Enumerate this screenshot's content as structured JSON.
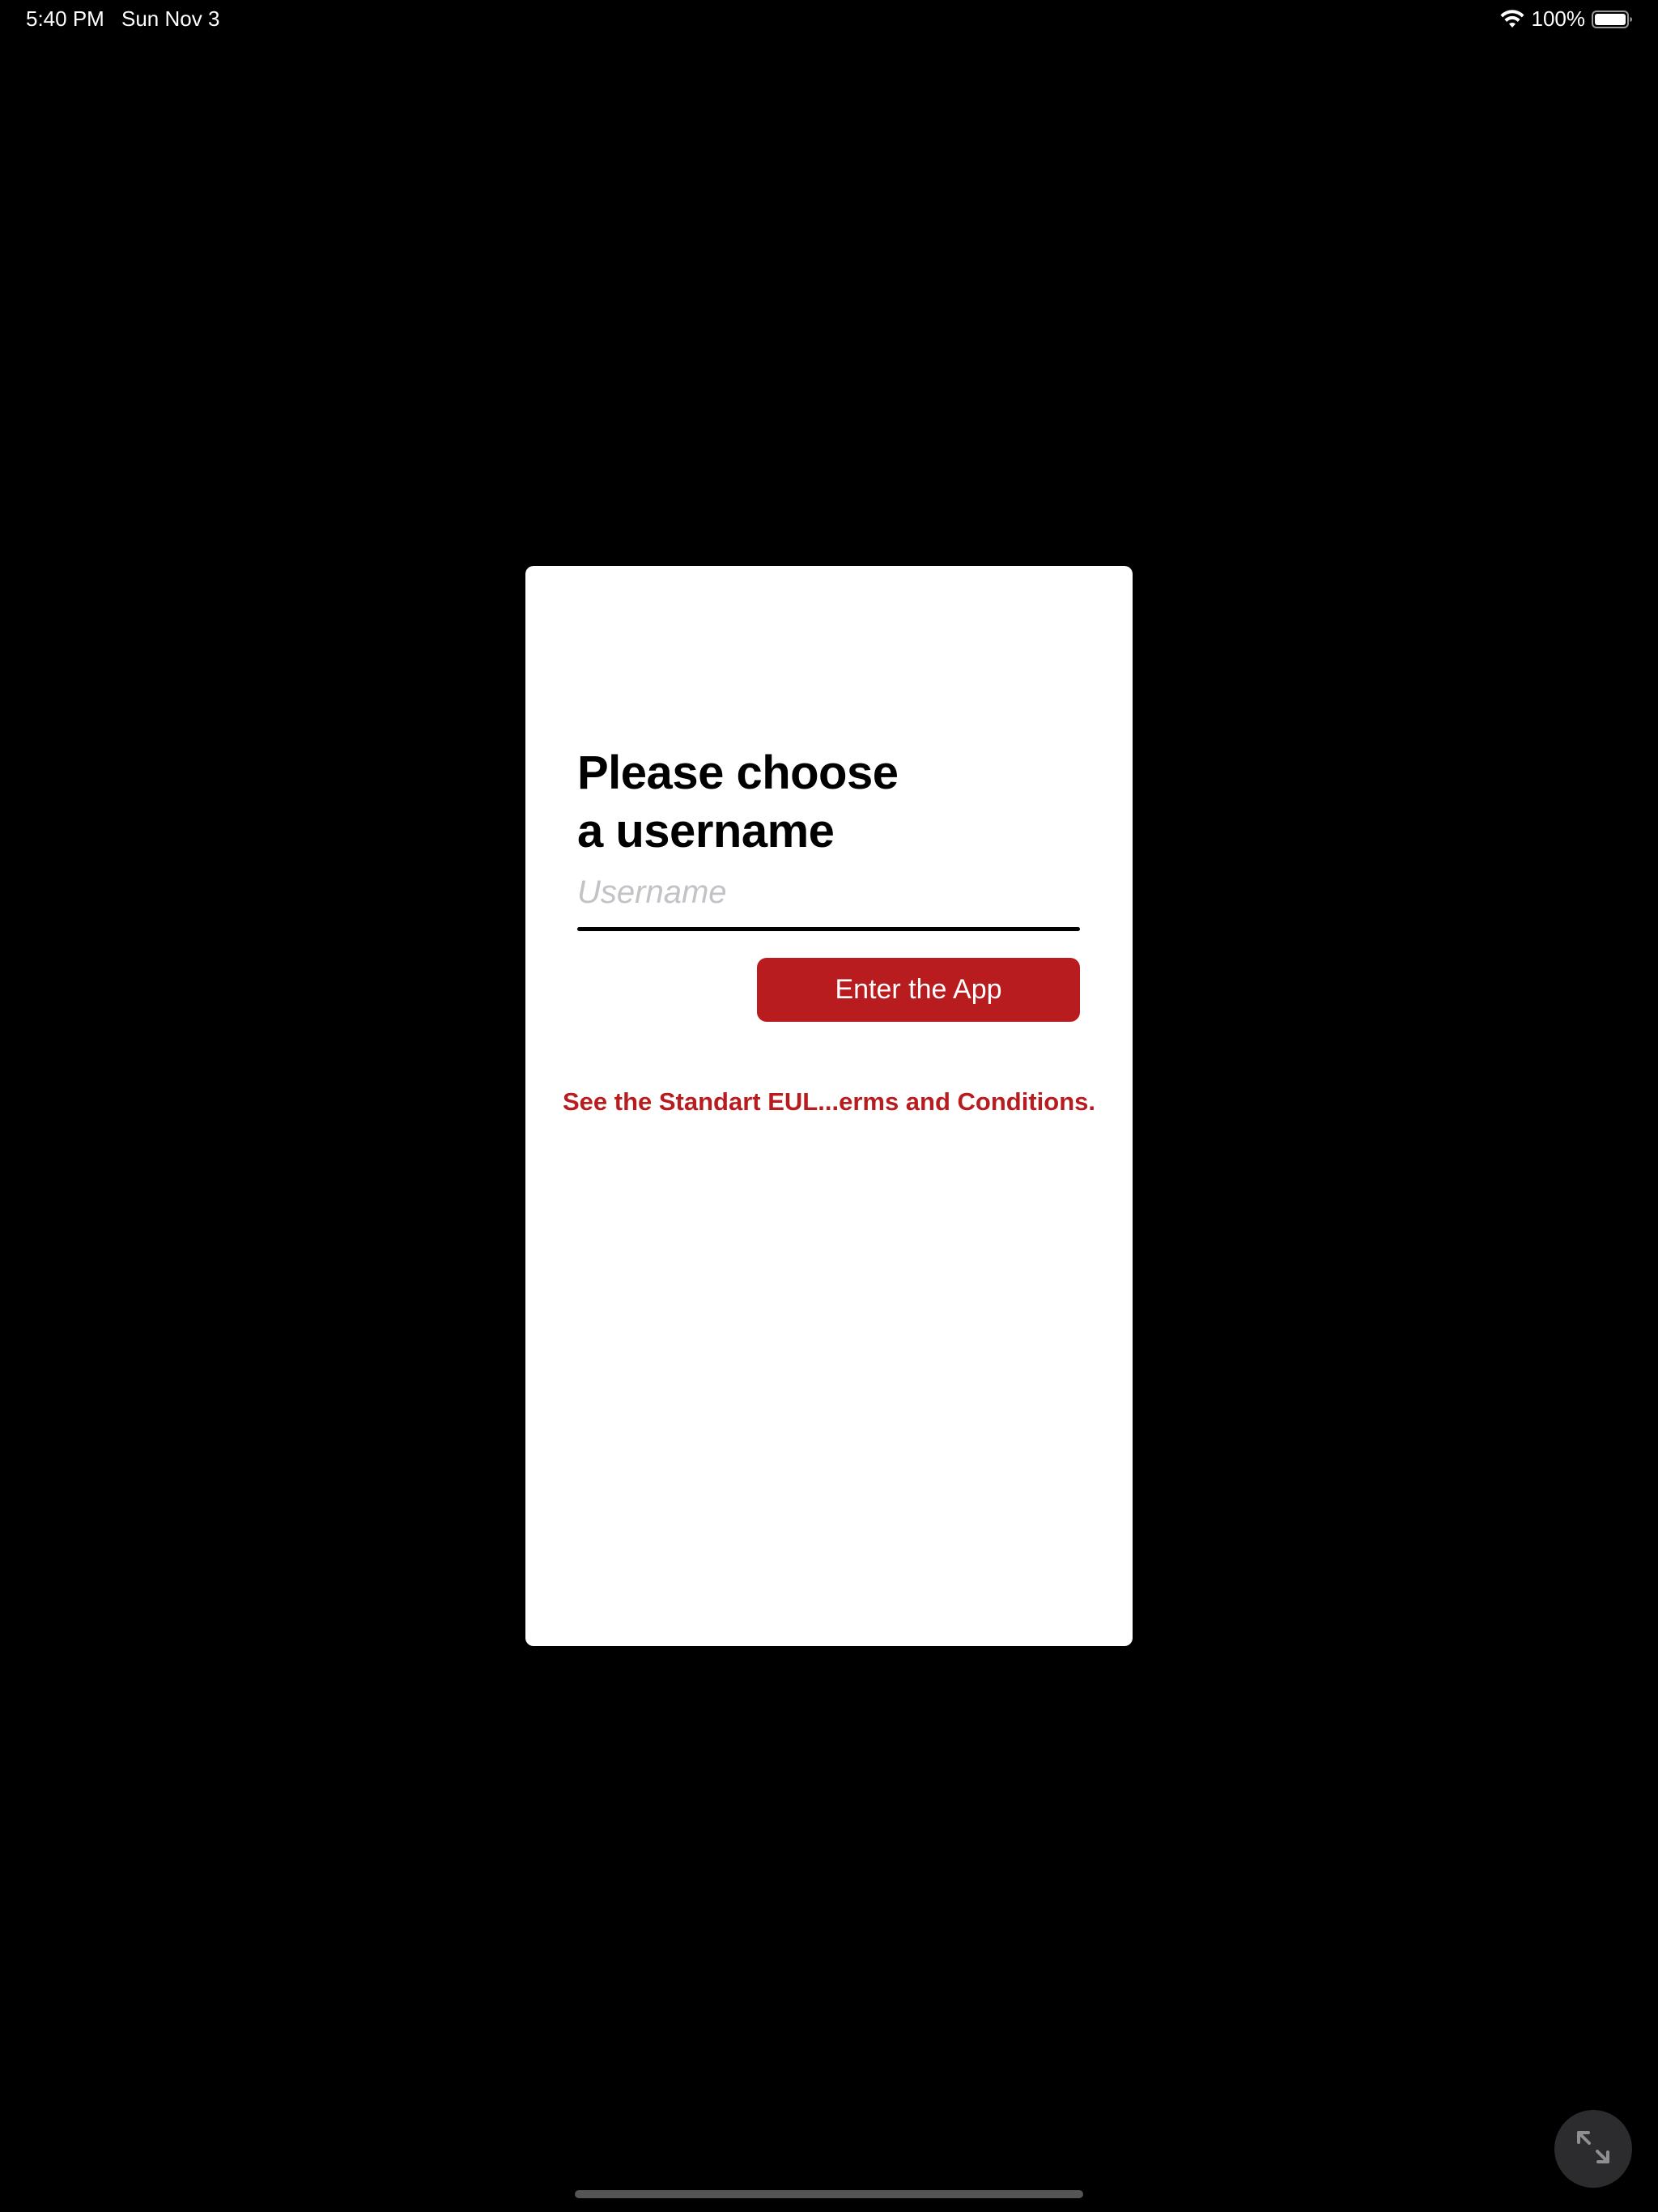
{
  "status_bar": {
    "time": "5:40 PM",
    "date": "Sun Nov 3",
    "battery_percent_label": "100%",
    "battery_level": 1.0,
    "wifi_icon": "wifi-icon",
    "battery_icon": "battery-icon"
  },
  "login_card": {
    "title_line1": "Please choose",
    "title_line2": "a username",
    "username_placeholder": "Username",
    "username_value": "",
    "enter_button_label": "Enter the App",
    "eula_link_text": "See the Standart EUL...erms and Conditions."
  },
  "controls": {
    "expand_icon": "expand-arrows-icon"
  },
  "colors": {
    "background": "#000000",
    "card": "#ffffff",
    "accent_red": "#b91c1f",
    "placeholder_gray": "#c2c2c7"
  }
}
